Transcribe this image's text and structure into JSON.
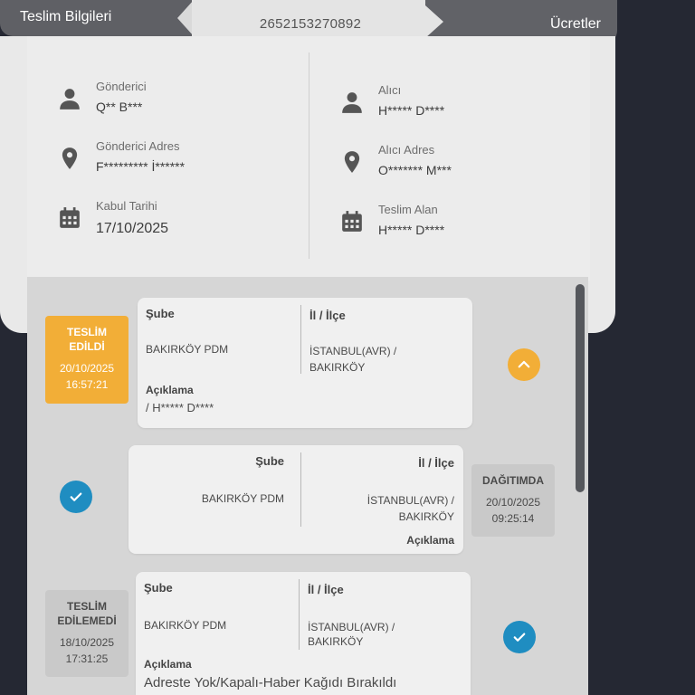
{
  "header": {
    "left_tab": "Teslim Bilgileri",
    "tracking_number": "2652153270892",
    "right_tab": "Ücretler"
  },
  "sender": {
    "name_label": "Gönderici",
    "name_value": "Q** B***",
    "address_label": "Gönderici Adres",
    "address_value": "F********* İ******",
    "date_label": "Kabul Tarihi",
    "date_value": "17/10/2025"
  },
  "receiver": {
    "name_label": "Alıcı",
    "name_value": "H***** D****",
    "address_label": "Alıcı Adres",
    "address_value": "O******* M***",
    "received_label": "Teslim Alan",
    "received_value": "H***** D****"
  },
  "colors": {
    "delivered": "#f2ae37",
    "check": "#1f8dc1",
    "status_gray": "#c9c9c9"
  },
  "timeline": [
    {
      "status": "TESLİM EDİLDİ",
      "status_line1": "TESLİM",
      "status_line2": "EDİLDİ",
      "date": "20/10/2025",
      "time": "16:57:21",
      "branch_label": "Şube",
      "branch": "BAKIRKÖY PDM",
      "city_label": "İl / İlçe",
      "city_line1": "İSTANBUL(AVR) /",
      "city_line2": "BAKIRKÖY",
      "note_label": "Açıklama",
      "note": "/ H***** D****",
      "toggle_icon": "chevron-up-icon"
    },
    {
      "status": "DAĞITIMDA",
      "date": "20/10/2025",
      "time": "09:25:14",
      "branch_label": "Şube",
      "branch": "BAKIRKÖY PDM",
      "city_label": "İl / İlçe",
      "city_line1": "İSTANBUL(AVR) /",
      "city_line2": "BAKIRKÖY",
      "note_label": "Açıklama",
      "toggle_icon": "check-icon"
    },
    {
      "status_line1": "TESLİM",
      "status_line2": "EDİLEMEDİ",
      "date": "18/10/2025",
      "time": "17:31:25",
      "branch_label": "Şube",
      "branch": "BAKIRKÖY PDM",
      "city_label": "İl / İlçe",
      "city_line1": "İSTANBUL(AVR) /",
      "city_line2": "BAKIRKÖY",
      "note_label": "Açıklama",
      "note": "Adreste Yok/Kapalı-Haber Kağıdı Bırakıldı",
      "toggle_icon": "check-icon"
    }
  ]
}
